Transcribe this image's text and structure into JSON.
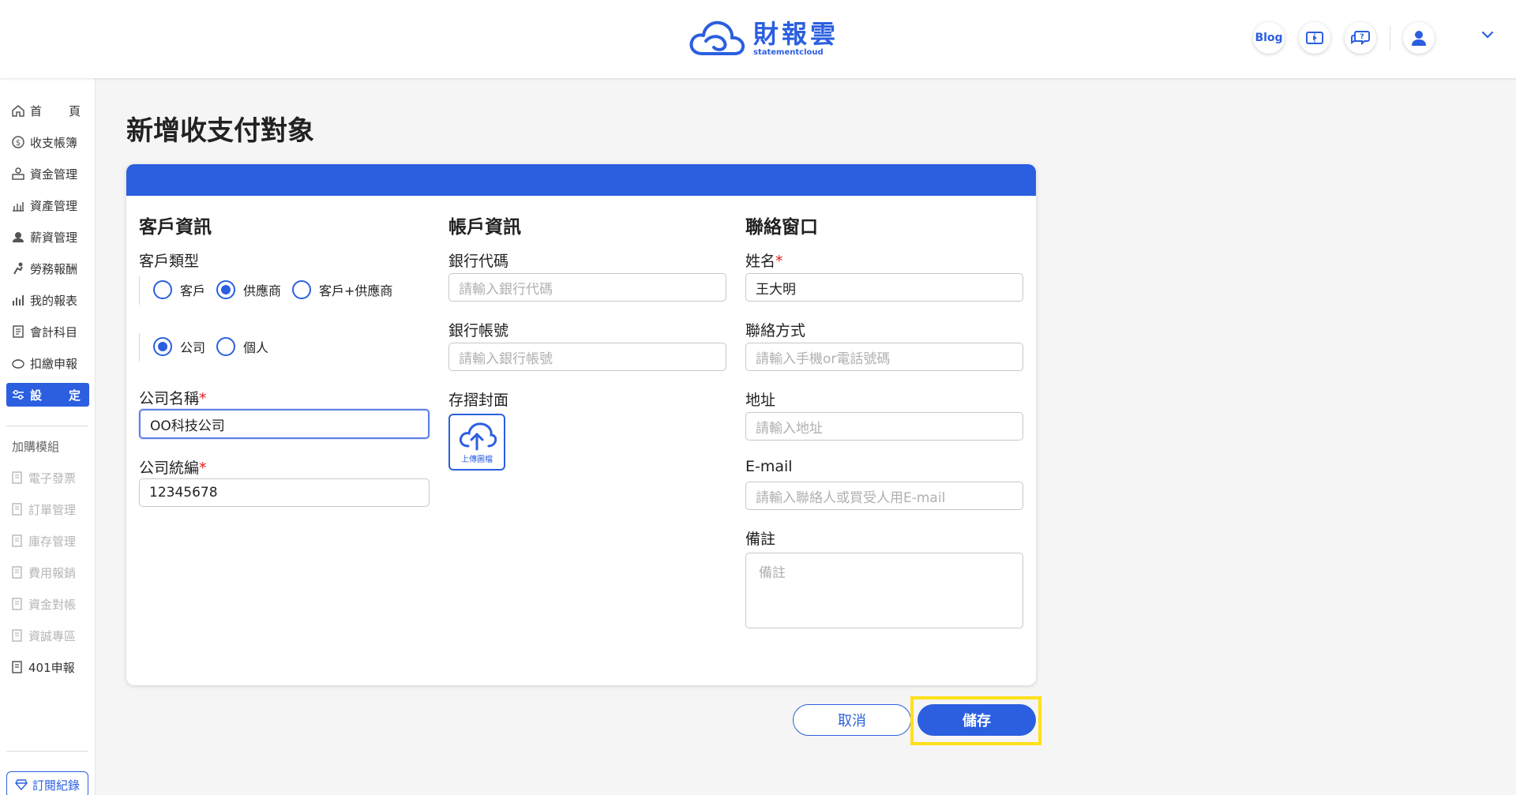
{
  "header": {
    "logo_main": "財報雲",
    "logo_sub": "statementcloud",
    "blog_label": "Blog"
  },
  "sidebar": {
    "items": [
      {
        "label_a": "首",
        "label_b": "頁",
        "icon": "home-icon"
      },
      {
        "label": "收支帳簿",
        "icon": "money-circle-icon"
      },
      {
        "label": "資金管理",
        "icon": "funds-icon"
      },
      {
        "label": "資產管理",
        "icon": "assets-chart-icon"
      },
      {
        "label": "薪資管理",
        "icon": "salary-icon"
      },
      {
        "label": "勞務報酬",
        "icon": "labor-icon"
      },
      {
        "label": "我的報表",
        "icon": "report-bars-icon"
      },
      {
        "label": "會計科目",
        "icon": "ledger-icon"
      },
      {
        "label": "扣繳申報",
        "icon": "piggy-icon"
      },
      {
        "label_a": "設",
        "label_b": "定",
        "icon": "settings-sliders-icon"
      }
    ],
    "addon_title": "加購模組",
    "addons": [
      "電子發票",
      "訂單管理",
      "庫存管理",
      "費用報銷",
      "資金對帳",
      "資誠專區",
      "401申報"
    ],
    "subscription_label": "訂閱紀錄"
  },
  "page": {
    "title": "新增收支付對象"
  },
  "customer": {
    "section_title": "客戶資訊",
    "type_label": "客戶類型",
    "type_options": [
      "客戶",
      "供應商",
      "客戶+供應商"
    ],
    "type_selected": "供應商",
    "entity_options": [
      "公司",
      "個人"
    ],
    "entity_selected": "公司",
    "company_name_label": "公司名稱",
    "company_name_value": "OO科技公司",
    "tax_id_label": "公司統編",
    "tax_id_value": "12345678",
    "required_mark": "*"
  },
  "account": {
    "section_title": "帳戶資訊",
    "bank_code_label": "銀行代碼",
    "bank_code_placeholder": "請輸入銀行代碼",
    "bank_account_label": "銀行帳號",
    "bank_account_placeholder": "請輸入銀行帳號",
    "passbook_label": "存摺封面",
    "upload_label": "上傳圖檔"
  },
  "contact": {
    "section_title": "聯絡窗口",
    "name_label": "姓名",
    "name_value": "王大明",
    "method_label": "聯絡方式",
    "method_placeholder": "請輸入手機or電話號碼",
    "address_label": "地址",
    "address_placeholder": "請輸入地址",
    "email_label": "E-mail",
    "email_placeholder": "請輸入聯絡人或買受人用E-mail",
    "note_label": "備註",
    "note_placeholder": "備註"
  },
  "actions": {
    "cancel_label": "取消",
    "save_label": "儲存"
  },
  "colors": {
    "accent": "#2b5fe0",
    "highlight": "#ffe01a",
    "required": "#e02020"
  }
}
